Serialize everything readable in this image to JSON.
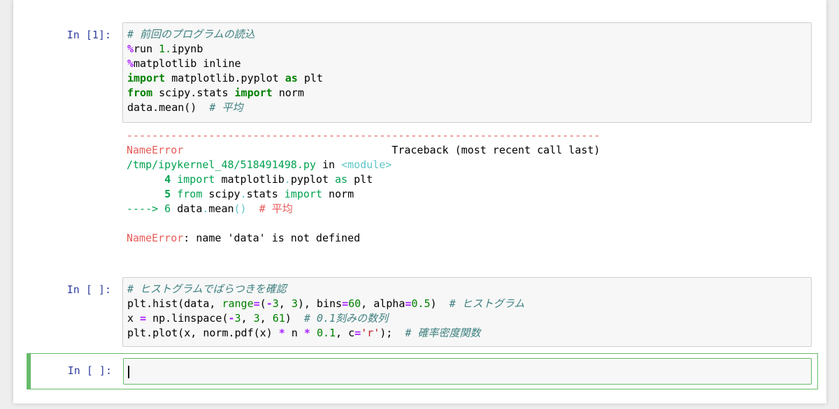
{
  "cells": [
    {
      "prompt": "In [1]:",
      "lines": [
        [
          {
            "t": "# 前回のプログラムの読込",
            "c": "c"
          }
        ],
        [
          {
            "t": "%",
            "c": "m"
          },
          {
            "t": "run "
          },
          {
            "t": "1.",
            "c": "n"
          },
          {
            "t": "ipynb"
          }
        ],
        [
          {
            "t": "%",
            "c": "m"
          },
          {
            "t": "matplotlib inline"
          }
        ],
        [
          {
            "t": "import",
            "c": "k"
          },
          {
            "t": " matplotlib.pyplot "
          },
          {
            "t": "as",
            "c": "k"
          },
          {
            "t": " plt"
          }
        ],
        [
          {
            "t": "from",
            "c": "k"
          },
          {
            "t": " scipy.stats "
          },
          {
            "t": "import",
            "c": "k"
          },
          {
            "t": " norm"
          }
        ],
        [
          {
            "t": "data.mean()  "
          },
          {
            "t": "# 平均",
            "c": "c"
          }
        ]
      ],
      "output": [
        [
          {
            "t": "---------------------------------------------------------------------------",
            "c": "err"
          }
        ],
        [
          {
            "t": "NameError",
            "c": "err"
          },
          {
            "t": "                                 Traceback (most recent call last)"
          }
        ],
        [
          {
            "t": "/tmp/ipykernel_48/518491498.py",
            "c": "grn"
          },
          {
            "t": " in "
          },
          {
            "t": "<module>",
            "c": "cyn"
          }
        ],
        [
          {
            "t": "      "
          },
          {
            "t": "4",
            "c": "bold grn"
          },
          {
            "t": " "
          },
          {
            "t": "import",
            "c": "grn"
          },
          {
            "t": " matplotlib"
          },
          {
            "t": ".",
            "c": "cyn"
          },
          {
            "t": "pyplot "
          },
          {
            "t": "as",
            "c": "grn"
          },
          {
            "t": " plt"
          }
        ],
        [
          {
            "t": "      "
          },
          {
            "t": "5",
            "c": "bold grn"
          },
          {
            "t": " "
          },
          {
            "t": "from",
            "c": "grn"
          },
          {
            "t": " scipy"
          },
          {
            "t": ".",
            "c": "cyn"
          },
          {
            "t": "stats "
          },
          {
            "t": "import",
            "c": "grn"
          },
          {
            "t": " norm"
          }
        ],
        [
          {
            "t": "----> 6",
            "c": "grn"
          },
          {
            "t": " data"
          },
          {
            "t": ".",
            "c": "cyn"
          },
          {
            "t": "mean"
          },
          {
            "t": "()",
            "c": "cyn"
          },
          {
            "t": "  "
          },
          {
            "t": "# 平均",
            "c": "err"
          }
        ],
        [
          {
            "t": " "
          }
        ],
        [
          {
            "t": "NameError",
            "c": "err"
          },
          {
            "t": ": name 'data' is not defined"
          }
        ]
      ]
    },
    {
      "prompt": "In [ ]:",
      "lines": [
        [
          {
            "t": "# ヒストグラムでばらつきを確認",
            "c": "c"
          }
        ],
        [
          {
            "t": "plt.hist(data, "
          },
          {
            "t": "range",
            "c": "n"
          },
          {
            "t": "=",
            "c": "o"
          },
          {
            "t": "("
          },
          {
            "t": "-",
            "c": "o"
          },
          {
            "t": "3",
            "c": "n"
          },
          {
            "t": ", "
          },
          {
            "t": "3",
            "c": "n"
          },
          {
            "t": "), bins"
          },
          {
            "t": "=",
            "c": "o"
          },
          {
            "t": "60",
            "c": "n"
          },
          {
            "t": ", alpha"
          },
          {
            "t": "=",
            "c": "o"
          },
          {
            "t": "0.5",
            "c": "n"
          },
          {
            "t": ")  "
          },
          {
            "t": "# ヒストグラム",
            "c": "c"
          }
        ],
        [
          {
            "t": "x "
          },
          {
            "t": "=",
            "c": "o"
          },
          {
            "t": " np.linspace("
          },
          {
            "t": "-",
            "c": "o"
          },
          {
            "t": "3",
            "c": "n"
          },
          {
            "t": ", "
          },
          {
            "t": "3",
            "c": "n"
          },
          {
            "t": ", "
          },
          {
            "t": "61",
            "c": "n"
          },
          {
            "t": ")  "
          },
          {
            "t": "# 0.1刻みの数列",
            "c": "c"
          }
        ],
        [
          {
            "t": "plt.plot(x, norm.pdf(x) "
          },
          {
            "t": "*",
            "c": "o"
          },
          {
            "t": " n "
          },
          {
            "t": "*",
            "c": "o"
          },
          {
            "t": " "
          },
          {
            "t": "0.1",
            "c": "n"
          },
          {
            "t": ", c"
          },
          {
            "t": "=",
            "c": "o"
          },
          {
            "t": "'r'",
            "c": "s"
          },
          {
            "t": ");  "
          },
          {
            "t": "# 確率密度関数",
            "c": "c"
          }
        ]
      ]
    },
    {
      "prompt": "In [ ]:",
      "lines": []
    }
  ]
}
